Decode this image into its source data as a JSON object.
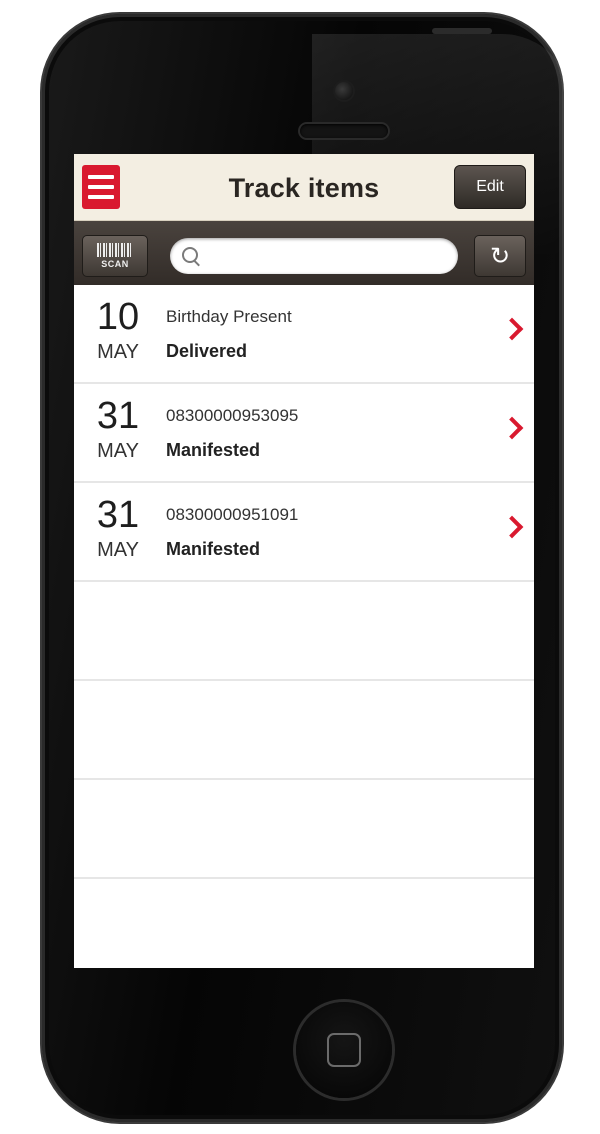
{
  "navbar": {
    "title": "Track items",
    "edit_label": "Edit"
  },
  "toolbar": {
    "scan_label": "SCAN",
    "search_placeholder": "",
    "refresh_icon": "↻"
  },
  "items": [
    {
      "day": "10",
      "month": "MAY",
      "name": "Birthday Present",
      "status": "Delivered"
    },
    {
      "day": "31",
      "month": "MAY",
      "name": "08300000953095",
      "status": "Manifested"
    },
    {
      "day": "31",
      "month": "MAY",
      "name": "08300000951091",
      "status": "Manifested"
    }
  ],
  "colors": {
    "accent": "#d9192f",
    "navbar_bg": "#f3eee2",
    "toolbar_bg": "#3c3530"
  }
}
